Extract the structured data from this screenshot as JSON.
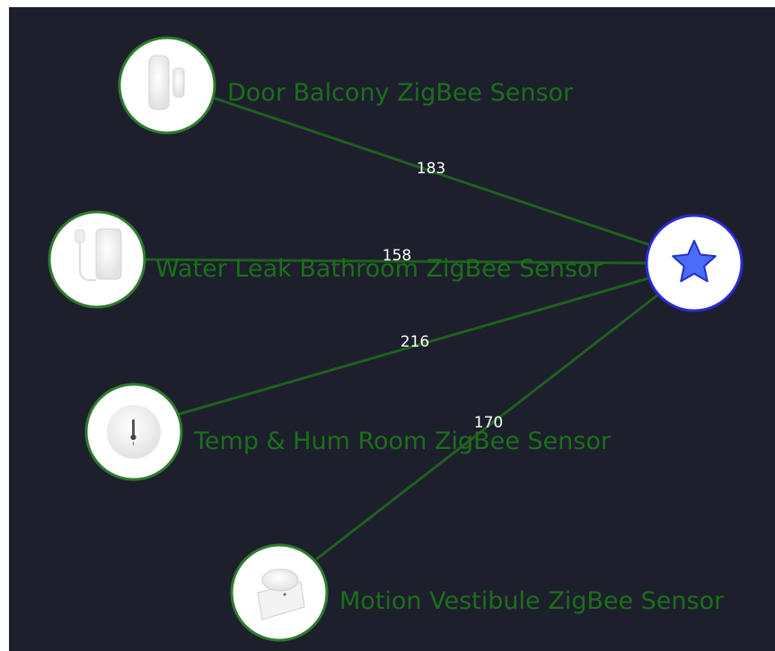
{
  "graph": {
    "colors": {
      "background": "#1d1f2c",
      "edge": "#1f5f1f",
      "device_border": "#2e7d2e",
      "hub_border": "#2a2ad6",
      "hub_star": "#4a6cf7",
      "label": "#1b6f1b",
      "edge_label": "#ffffff"
    },
    "hub": {
      "icon": "star-icon"
    },
    "devices": [
      {
        "name": "Door Balcony ZigBee Sensor",
        "icon": "door-sensor-icon",
        "link_quality": "183"
      },
      {
        "name": "Water Leak Bathroom ZigBee Sensor",
        "icon": "water-leak-sensor-icon",
        "link_quality": "158"
      },
      {
        "name": "Temp & Hum Room ZigBee Sensor",
        "icon": "thermometer-icon",
        "link_quality": "216"
      },
      {
        "name": "Motion Vestibule ZigBee Sensor",
        "icon": "motion-sensor-icon",
        "link_quality": "170"
      }
    ]
  }
}
